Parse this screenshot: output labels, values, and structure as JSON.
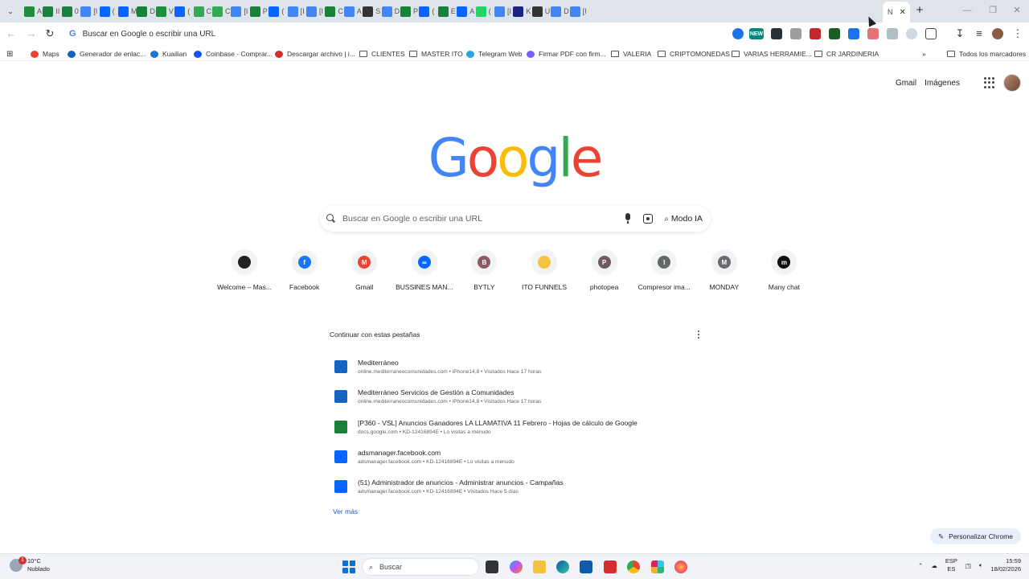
{
  "tabs": [
    {
      "icon": "drive-icon",
      "title": "A",
      "color": "#1e8e3e"
    },
    {
      "icon": "sheets-icon",
      "title": "II",
      "color": "#188038"
    },
    {
      "icon": "sheets-icon",
      "title": "0",
      "color": "#188038"
    },
    {
      "icon": "loading-icon",
      "title": "[I",
      "color": "#4285f4"
    },
    {
      "icon": "meta-icon",
      "title": "(",
      "color": "#0866ff"
    },
    {
      "icon": "meta-icon",
      "title": "M",
      "color": "#0866ff"
    },
    {
      "icon": "sheets-icon",
      "title": "D",
      "color": "#188038"
    },
    {
      "icon": "drive-icon",
      "title": "V",
      "color": "#1e8e3e"
    },
    {
      "icon": "meta-icon",
      "title": "(",
      "color": "#0866ff"
    },
    {
      "icon": "ads-icon",
      "title": "C",
      "color": "#34a853"
    },
    {
      "icon": "ads-icon",
      "title": "C",
      "color": "#34a853"
    },
    {
      "icon": "loading-icon",
      "title": "[I",
      "color": "#4285f4"
    },
    {
      "icon": "sheets-icon",
      "title": "P",
      "color": "#188038"
    },
    {
      "icon": "meta-icon",
      "title": "(",
      "color": "#0866ff"
    },
    {
      "icon": "loading-icon",
      "title": "[I",
      "color": "#4285f4"
    },
    {
      "icon": "loading-icon",
      "title": "[I",
      "color": "#4285f4"
    },
    {
      "icon": "sheets-icon",
      "title": "C",
      "color": "#188038"
    },
    {
      "icon": "docs-icon",
      "title": "A",
      "color": "#4285f4"
    },
    {
      "icon": "globe-icon",
      "title": "S",
      "color": "#333333"
    },
    {
      "icon": "loading-icon",
      "title": "D",
      "color": "#4285f4"
    },
    {
      "icon": "sheets-icon",
      "title": "P",
      "color": "#188038"
    },
    {
      "icon": "meta-icon",
      "title": "(",
      "color": "#0866ff"
    },
    {
      "icon": "sheets-icon",
      "title": "E",
      "color": "#188038"
    },
    {
      "icon": "meta-icon",
      "title": "A",
      "color": "#0866ff"
    },
    {
      "icon": "whatsapp-icon",
      "title": "(",
      "color": "#25d366"
    },
    {
      "icon": "loading-icon",
      "title": "[I",
      "color": "#4285f4"
    },
    {
      "icon": "k-icon",
      "title": "K",
      "color": "#1a237e"
    },
    {
      "icon": "globe-icon",
      "title": "U",
      "color": "#333333"
    },
    {
      "icon": "docs-icon",
      "title": "D",
      "color": "#4285f4"
    },
    {
      "icon": "loading-icon",
      "title": "[I",
      "color": "#4285f4"
    }
  ],
  "active_tab": {
    "title": "N"
  },
  "omnibox": {
    "text": "Buscar en Google o escribir una URL"
  },
  "bookmarks": [
    {
      "label": "Maps",
      "icon": "maps-icon"
    },
    {
      "label": "Generador de enlac...",
      "icon": "link-icon"
    },
    {
      "label": "Kuailian",
      "icon": "kuailian-icon"
    },
    {
      "label": "Coinbase - Comprar...",
      "icon": "coinbase-icon"
    },
    {
      "label": "Descargar archivo | i...",
      "icon": "heart-icon"
    },
    {
      "label": "CLIENTES",
      "icon": "folder-icon"
    },
    {
      "label": "MASTER ITO",
      "icon": "folder-icon"
    },
    {
      "label": "Telegram Web",
      "icon": "telegram-icon"
    },
    {
      "label": "Firmar PDF con firm...",
      "icon": "pdf-icon"
    },
    {
      "label": "VALERIA",
      "icon": "folder-icon"
    },
    {
      "label": "CRIPTOMONEDAS",
      "icon": "folder-icon"
    },
    {
      "label": "VARIAS HERRAMIE...",
      "icon": "folder-icon"
    },
    {
      "label": "CR JARDINERIA",
      "icon": "folder-icon"
    }
  ],
  "bookmarks_more": "»",
  "all_bookmarks": "Todos los marcadores",
  "header_links": {
    "gmail": "Gmail",
    "images": "Imágenes"
  },
  "logo": [
    "G",
    "o",
    "o",
    "g",
    "l",
    "e"
  ],
  "logo_colors": [
    "#4285f4",
    "#ea4335",
    "#fbbc05",
    "#4285f4",
    "#34a853",
    "#ea4335"
  ],
  "search": {
    "placeholder": "Buscar en Google o escribir una URL",
    "ai_mode": "Modo IA"
  },
  "shortcuts": [
    {
      "label": "Welcome – Mas...",
      "letter": "",
      "color": "#222222"
    },
    {
      "label": "Facebook",
      "letter": "f",
      "color": "#1877f2"
    },
    {
      "label": "Gmail",
      "letter": "M",
      "color": "#ea4335"
    },
    {
      "label": "BUSSINES MAN...",
      "letter": "∞",
      "color": "#0866ff"
    },
    {
      "label": "BYTLY",
      "letter": "B",
      "color": "#8e5a64"
    },
    {
      "label": "ITO FUNNELS",
      "letter": "",
      "color": "#f5c242"
    },
    {
      "label": "photopea",
      "letter": "P",
      "color": "#6e5a60"
    },
    {
      "label": "Compresor ima...",
      "letter": "I",
      "color": "#5f6b64"
    },
    {
      "label": "MONDAY",
      "letter": "M",
      "color": "#6a6a73"
    },
    {
      "label": "Many chat",
      "letter": "m",
      "color": "#111111"
    }
  ],
  "continue": {
    "heading": "Continuar con estas pestañas",
    "items": [
      {
        "title": "Mediterráneo",
        "subtitle": "online.mediterraneocomunidades.com • iPhone14,8 • Visitados Hace 17 horas",
        "icon": "mediterraneo-icon",
        "color": "#1565c0"
      },
      {
        "title": "Mediterráneo Servicios de Gestión a Comunidades",
        "subtitle": "online.mediterraneocomunidades.com • iPhone14,8 • Visitados Hace 17 horas",
        "icon": "mediterraneo-icon",
        "color": "#1565c0"
      },
      {
        "title": "[P360 - VSL] Anuncios Ganadores LA LLAMATIVA 11 Febrero - Hojas de cálculo de Google",
        "subtitle": "docs.google.com • KD-12416894E • Lo visitas a menudo",
        "icon": "sheets-icon",
        "color": "#188038"
      },
      {
        "title": "adsmanager.facebook.com",
        "subtitle": "adsmanager.facebook.com • KD-12416894E • Lo visitas a menudo",
        "icon": "meta-icon",
        "color": "#0866ff"
      },
      {
        "title": "(51) Administrador de anuncios - Administrar anuncios - Campañas",
        "subtitle": "adsmanager.facebook.com • KD-12416894E • Visitados Hace 5 días",
        "icon": "meta-icon",
        "color": "#0866ff"
      }
    ],
    "more": "Ver más"
  },
  "customize": "Personalizar Chrome",
  "taskbar": {
    "weather_temp": "10°C",
    "weather_desc": "Nublado",
    "weather_badge": "1",
    "search": "Buscar",
    "lang_top": "ESP",
    "lang_bottom": "ES",
    "time": "15:59",
    "date": "18/02/2026"
  }
}
